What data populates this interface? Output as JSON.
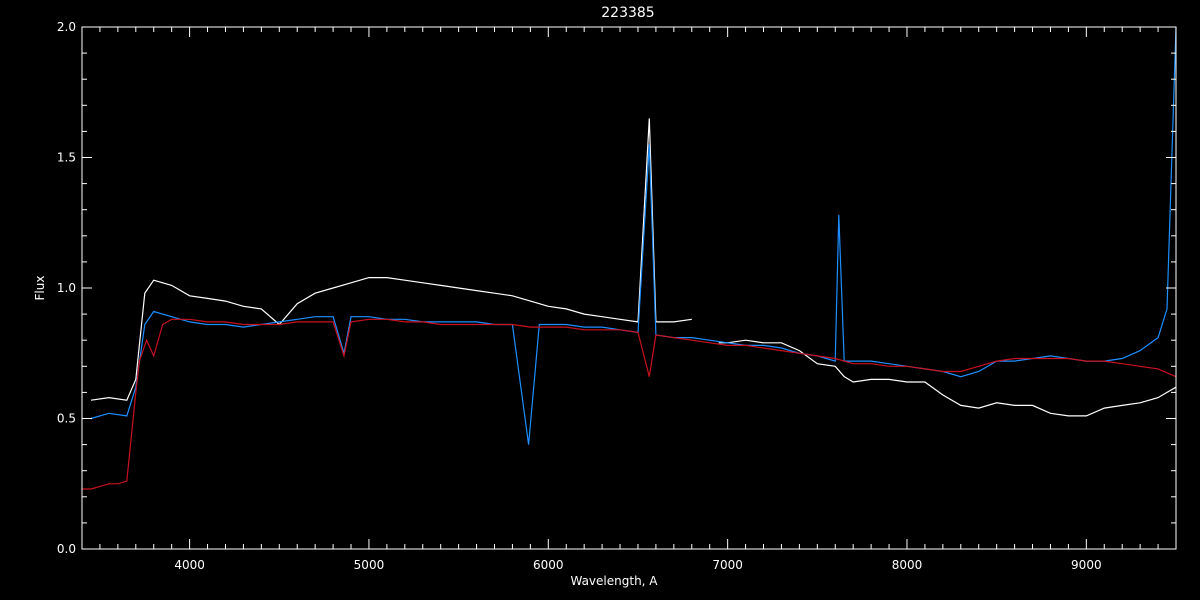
{
  "chart_data": {
    "type": "line",
    "title": "223385",
    "xlabel": "Wavelength, A",
    "ylabel": "Flux",
    "xlim": [
      3400,
      9500
    ],
    "ylim": [
      0.0,
      2.0
    ],
    "x_ticks": [
      4000,
      5000,
      6000,
      7000,
      8000,
      9000
    ],
    "x_tick_labels": [
      "4000",
      "5000",
      "6000",
      "7000",
      "8000",
      "9000"
    ],
    "y_ticks": [
      0.0,
      0.5,
      1.0,
      1.5,
      2.0
    ],
    "y_tick_labels": [
      "0.0",
      "0.5",
      "1.0",
      "1.5",
      "2.0"
    ],
    "grid": false,
    "background": "#000000",
    "axis_color": "#ffffff",
    "series": [
      {
        "color": "#ffffff",
        "x": [
          3450,
          3550,
          3650,
          3700,
          3750,
          3800,
          3900,
          4000,
          4100,
          4200,
          4300,
          4400,
          4500,
          4600,
          4700,
          4800,
          4900,
          5000,
          5100,
          5200,
          5300,
          5400,
          5500,
          5600,
          5700,
          5800,
          5900,
          6000,
          6100,
          6200,
          6300,
          6400,
          6500,
          6563,
          6600,
          6700,
          6800,
          null,
          6950,
          7000,
          7100,
          7200,
          7300,
          7400,
          7500,
          7600,
          7650,
          7700,
          7800,
          7900,
          8000,
          8100,
          8200,
          8300,
          8400,
          8500,
          8600,
          8700,
          8800,
          8900,
          9000,
          9100,
          9200,
          9300,
          9400,
          9450,
          9500
        ],
        "y": [
          0.57,
          0.58,
          0.57,
          0.65,
          0.98,
          1.03,
          1.01,
          0.97,
          0.96,
          0.95,
          0.93,
          0.92,
          0.86,
          0.94,
          0.98,
          1.0,
          1.02,
          1.04,
          1.04,
          1.03,
          1.02,
          1.01,
          1.0,
          0.99,
          0.98,
          0.97,
          0.95,
          0.93,
          0.92,
          0.9,
          0.89,
          0.88,
          0.87,
          1.65,
          0.87,
          0.87,
          0.88,
          null,
          0.79,
          0.79,
          0.8,
          0.79,
          0.79,
          0.76,
          0.71,
          0.7,
          0.66,
          0.64,
          0.65,
          0.65,
          0.64,
          0.64,
          0.59,
          0.55,
          0.54,
          0.56,
          0.55,
          0.55,
          0.52,
          0.51,
          0.51,
          0.54,
          0.55,
          0.56,
          0.58,
          0.6,
          0.62
        ]
      },
      {
        "color": "#1e8fff",
        "x": [
          3450,
          3550,
          3650,
          3700,
          3750,
          3800,
          3900,
          4000,
          4100,
          4200,
          4300,
          4400,
          4500,
          4600,
          4700,
          4800,
          4861,
          4900,
          5000,
          5100,
          5200,
          5300,
          5400,
          5500,
          5600,
          5700,
          5800,
          5890,
          5950,
          6000,
          6100,
          6200,
          6300,
          6400,
          6500,
          6563,
          6600,
          6700,
          6800,
          6900,
          7000,
          7100,
          7200,
          7300,
          7400,
          7500,
          7600,
          7620,
          7650,
          7700,
          7800,
          7900,
          8000,
          8100,
          8200,
          8300,
          8400,
          8500,
          8600,
          8700,
          8800,
          8900,
          9000,
          9100,
          9200,
          9300,
          9400,
          9450,
          9500
        ],
        "y": [
          0.5,
          0.52,
          0.51,
          0.62,
          0.86,
          0.91,
          0.89,
          0.87,
          0.86,
          0.86,
          0.85,
          0.86,
          0.87,
          0.88,
          0.89,
          0.89,
          0.75,
          0.89,
          0.89,
          0.88,
          0.88,
          0.87,
          0.87,
          0.87,
          0.87,
          0.86,
          0.86,
          0.4,
          0.86,
          0.86,
          0.86,
          0.85,
          0.85,
          0.84,
          0.83,
          1.55,
          0.82,
          0.81,
          0.81,
          0.8,
          0.79,
          0.78,
          0.78,
          0.77,
          0.75,
          0.74,
          0.72,
          1.28,
          0.72,
          0.72,
          0.72,
          0.71,
          0.7,
          0.69,
          0.68,
          0.66,
          0.68,
          0.72,
          0.72,
          0.73,
          0.74,
          0.73,
          0.72,
          0.72,
          0.73,
          0.76,
          0.81,
          0.92,
          2.0
        ]
      },
      {
        "color": "#c8121e",
        "x": [
          3400,
          3450,
          3500,
          3550,
          3600,
          3650,
          3700,
          3720,
          3760,
          3800,
          3850,
          3900,
          4000,
          4100,
          4200,
          4300,
          4400,
          4500,
          4600,
          4700,
          4800,
          4861,
          4900,
          5000,
          5100,
          5200,
          5300,
          5400,
          5500,
          5600,
          5700,
          5800,
          5900,
          6000,
          6100,
          6200,
          6300,
          6400,
          6500,
          6563,
          6600,
          6700,
          6800,
          6900,
          7000,
          7100,
          7200,
          7300,
          7400,
          7500,
          7600,
          7700,
          7800,
          7900,
          8000,
          8100,
          8200,
          8300,
          8400,
          8500,
          8600,
          8700,
          8800,
          8900,
          9000,
          9100,
          9200,
          9300,
          9400,
          9500
        ],
        "y": [
          0.23,
          0.23,
          0.24,
          0.25,
          0.25,
          0.26,
          0.6,
          0.72,
          0.8,
          0.74,
          0.86,
          0.88,
          0.88,
          0.87,
          0.87,
          0.86,
          0.86,
          0.86,
          0.87,
          0.87,
          0.87,
          0.74,
          0.87,
          0.88,
          0.88,
          0.87,
          0.87,
          0.86,
          0.86,
          0.86,
          0.86,
          0.86,
          0.85,
          0.85,
          0.85,
          0.84,
          0.84,
          0.84,
          0.83,
          0.66,
          0.82,
          0.81,
          0.8,
          0.79,
          0.78,
          0.78,
          0.77,
          0.76,
          0.75,
          0.74,
          0.73,
          0.71,
          0.71,
          0.7,
          0.7,
          0.69,
          0.68,
          0.68,
          0.7,
          0.72,
          0.73,
          0.73,
          0.73,
          0.73,
          0.72,
          0.72,
          0.71,
          0.7,
          0.69,
          0.66
        ]
      }
    ]
  }
}
